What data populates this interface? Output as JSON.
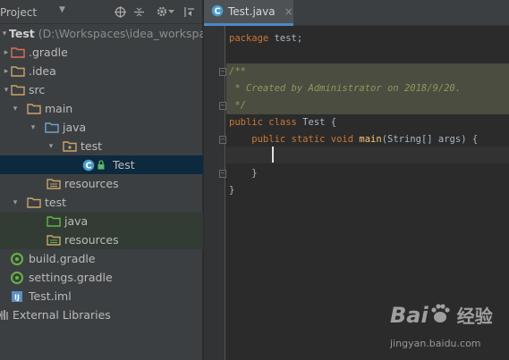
{
  "project_panel": {
    "title": "Project",
    "tree": [
      {
        "name": "Test",
        "extra": "(D:\\Workspaces\\idea_workspac",
        "arrow": "▾",
        "icon": "module-folder-icon"
      },
      {
        "name": ".gradle",
        "arrow": "▸",
        "icon": "folder-red-icon"
      },
      {
        "name": ".idea",
        "arrow": "▸",
        "icon": "folder-icon"
      },
      {
        "name": "src",
        "arrow": "▾",
        "icon": "folder-icon"
      },
      {
        "name": "main",
        "arrow": "▾",
        "icon": "folder-icon"
      },
      {
        "name": "java",
        "arrow": "▾",
        "icon": "source-folder-icon"
      },
      {
        "name": "test",
        "arrow": "▾",
        "icon": "package-folder-icon"
      },
      {
        "name": "Test",
        "arrow": "",
        "icon": "class-icon"
      },
      {
        "name": "resources",
        "arrow": "",
        "icon": "resources-folder-icon"
      },
      {
        "name": "test",
        "arrow": "▾",
        "icon": "folder-icon"
      },
      {
        "name": "java",
        "arrow": "",
        "icon": "test-source-folder-icon"
      },
      {
        "name": "resources",
        "arrow": "",
        "icon": "test-resources-folder-icon"
      },
      {
        "name": "build.gradle",
        "arrow": "",
        "icon": "gradle-file-icon"
      },
      {
        "name": "settings.gradle",
        "arrow": "",
        "icon": "gradle-file-icon"
      },
      {
        "name": "Test.iml",
        "arrow": "",
        "icon": "iml-file-icon"
      },
      {
        "name": "External Libraries",
        "arrow": "▸",
        "icon": "libraries-icon"
      }
    ]
  },
  "editor": {
    "tab": {
      "label": "Test.java",
      "close": "×"
    },
    "lines": {
      "l1_kw": "package",
      "l1_rest": " test;",
      "l2": "/**",
      "l3": " * Created by Administrator on 2018/9/20.",
      "l4": " */",
      "l5_kw": "public class",
      "l5_rest": " Test {",
      "l6_kw1": "    public static void",
      "l6_fn": " main",
      "l6_rest": "(String[] args) {",
      "l8": "    }",
      "l9": "}"
    }
  },
  "watermark": {
    "logo_text": "Bai",
    "logo_cn": "经验",
    "url": "jingyan.baidu.com"
  },
  "colors": {
    "background": "#2b2b2b",
    "panel": "#3c3f41",
    "selection": "#0d293e",
    "keyword": "#cc7832",
    "comment": "#8e9a5e",
    "function": "#ffc66d"
  }
}
